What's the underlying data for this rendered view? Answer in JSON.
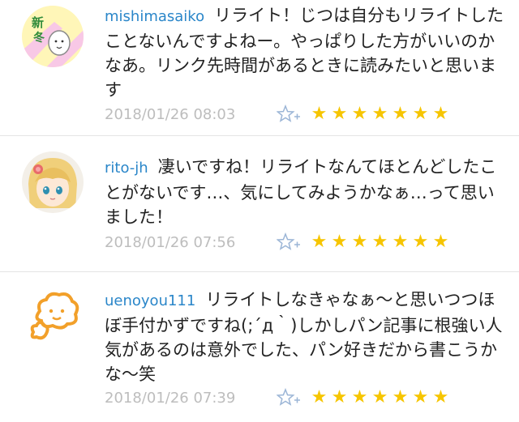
{
  "comments": [
    {
      "user": "mishimasaiko",
      "text": "リライト！じつは自分もリライトしたことないんですよねー。やっぱりした方がいいのかなあ。リンク先時間があるときに読みたいと思います",
      "timestamp": "2018/01/26 08:03",
      "avatar_text": "新冬",
      "stars": [
        "★",
        "★",
        "★",
        "★",
        "★",
        "★",
        "★"
      ]
    },
    {
      "user": "rito-jh",
      "text": "凄いですね！リライトなんてほとんどしたことがないです…、気にしてみようかなぁ…って思いました！",
      "timestamp": "2018/01/26 07:56",
      "stars": [
        "★",
        "★",
        "★",
        "★",
        "★",
        "★",
        "★"
      ]
    },
    {
      "user": "uenoyou111",
      "text": "リライトしなきゃなぁ〜と思いつつほぼ手付かずですね(;´д｀)しかしパン記事に根強い人気があるのは意外でした、パン好きだから書こうかな〜笑",
      "timestamp": "2018/01/26 07:39",
      "stars": [
        "★",
        "★",
        "★",
        "★",
        "★",
        "★",
        "★"
      ]
    }
  ],
  "colors": {
    "username": "#2a86c9",
    "timestamp": "#bdbdbd",
    "star": "#f6c500",
    "add_star_icon": "#9bb5d6"
  }
}
